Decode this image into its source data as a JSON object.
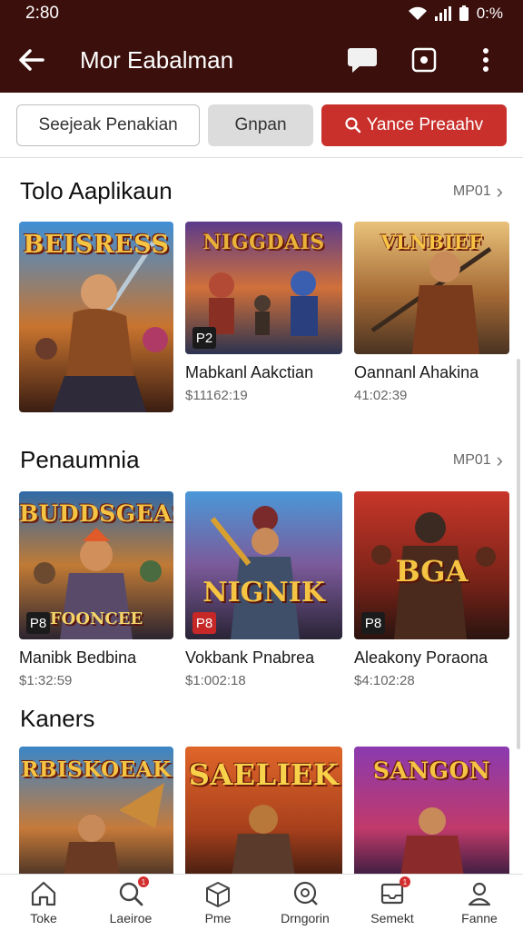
{
  "status_bar": {
    "time": "2:80",
    "battery": "0:%"
  },
  "app_bar": {
    "title": "Mor Eabalman"
  },
  "filters": {
    "chip1": "Seejeak Penakian",
    "chip2": "Gnpan",
    "chip3": "Yance Preaahv"
  },
  "sections": [
    {
      "title": "Tolo Aaplikaun",
      "more": "MP01",
      "cards": [
        {
          "art_title": "BEISRESS",
          "art_sub": "",
          "badge": "",
          "name": "",
          "price": ""
        },
        {
          "art_title": "NIGGDAIS",
          "art_sub": "",
          "badge": "P2",
          "name": "Mabkanl Aakctian",
          "price": "$11162:19"
        },
        {
          "art_title": "VLNBIEF",
          "art_sub": "",
          "badge": "",
          "name": "Oannanl Ahakina",
          "price": "41:02:39"
        }
      ]
    },
    {
      "title": "Penaumnia",
      "more": "MP01",
      "cards": [
        {
          "art_title": "BUDDSGEAS",
          "art_sub": "FOONCEE",
          "badge": "P8",
          "name": "Manibk Bedbina",
          "price": "$1:32:59"
        },
        {
          "art_title": "",
          "art_sub": "NIGNIK",
          "badge": "P8",
          "name": "Vokbank Pnabrea",
          "price": "$1:002:18"
        },
        {
          "art_title": "",
          "art_sub": "BGA",
          "badge": "P8",
          "name": "Aleakony Poraona",
          "price": "$4:102:28"
        }
      ]
    },
    {
      "title": "Kaners",
      "more": "",
      "cards": [
        {
          "art_title": "RBISKOEAK",
          "art_sub": "",
          "badge": "",
          "name": "",
          "price": ""
        },
        {
          "art_title": "SAELIEK",
          "art_sub": "",
          "badge": "",
          "name": "",
          "price": ""
        },
        {
          "art_title": "SANGON",
          "art_sub": "",
          "badge": "",
          "name": "",
          "price": ""
        }
      ]
    }
  ],
  "bottom_nav": [
    {
      "label": "Toke",
      "icon": "home-icon"
    },
    {
      "label": "Laeiroe",
      "icon": "search-icon",
      "badge": "1"
    },
    {
      "label": "Pme",
      "icon": "box-icon"
    },
    {
      "label": "Drngorin",
      "icon": "discover-icon"
    },
    {
      "label": "Semekt",
      "icon": "inbox-icon",
      "badge": "1"
    },
    {
      "label": "Fanne",
      "icon": "profile-icon"
    }
  ],
  "colors": {
    "header": "#3a0f0c",
    "accent": "#c9302c"
  }
}
